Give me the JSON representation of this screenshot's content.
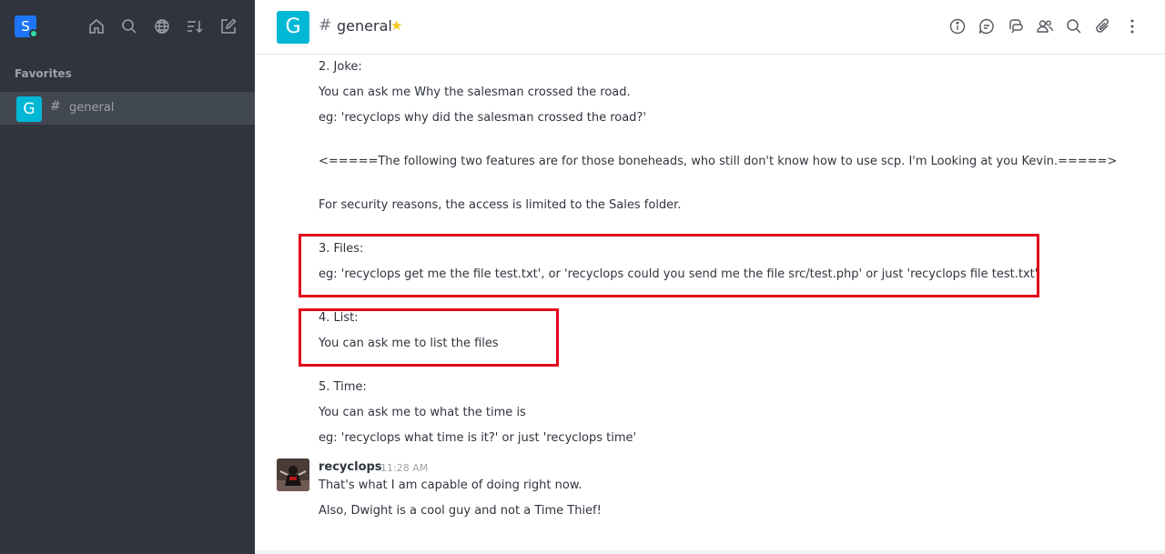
{
  "sidebar": {
    "user_avatar_letter": "S",
    "section_label": "Favorites",
    "room": {
      "avatar_letter": "G",
      "hash": "#",
      "label": "general"
    },
    "tools": [
      "home-icon",
      "search-icon",
      "globe-icon",
      "sort-icon",
      "create-icon"
    ]
  },
  "header": {
    "avatar_letter": "G",
    "hash": "#",
    "title": "general",
    "star": "★",
    "tools": [
      "info-icon",
      "discussion-icon",
      "threads-icon",
      "members-icon",
      "search-icon",
      "attachment-icon",
      "kebab-icon"
    ]
  },
  "messages": {
    "lines": [
      "2. Joke:",
      "You can ask me Why the salesman crossed the road.",
      "eg: 'recyclops why did the salesman crossed the road?'",
      "<=====The following two features are for those boneheads, who still don't know how to use scp. I'm Looking at you Kevin.=====>",
      "For security reasons, the access is limited to the Sales folder.",
      "3. Files:",
      "eg: 'recyclops get me the file test.txt', or 'recyclops could you send me the file src/test.php' or just 'recyclops file test.txt'",
      "4. List:",
      "You can ask me to list the files",
      "5. Time:",
      "You can ask me to what the time is",
      "eg: 'recyclops what time is it?' or just 'recyclops time'"
    ],
    "last": {
      "author": "recyclops",
      "time": "11:28 AM",
      "lines": [
        "That's what I am capable of doing right now.",
        "Also, Dwight is a cool guy and not a Time Thief!"
      ]
    }
  },
  "colors": {
    "sidebar_bg": "#2f343d",
    "accent": "#00b7d5",
    "highlight_border": "#e3001b",
    "star": "#f5c518"
  }
}
